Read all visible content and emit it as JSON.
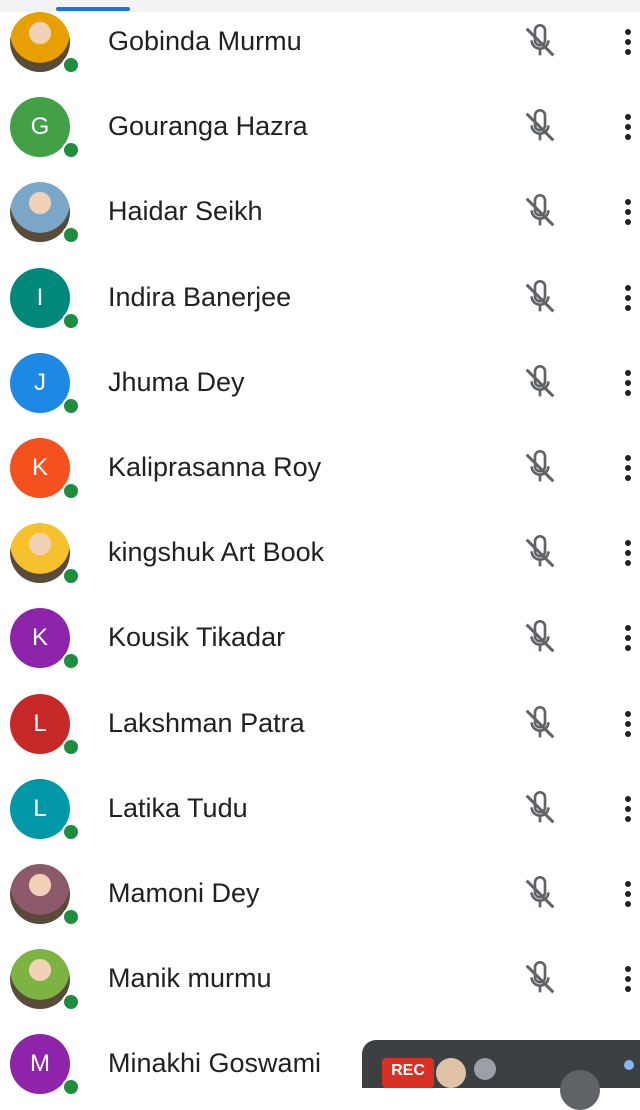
{
  "participants": [
    {
      "name": "Gobinda Murmu",
      "initial": "",
      "avatar": "photo",
      "color": "#e8a000"
    },
    {
      "name": "Gouranga Hazra",
      "initial": "G",
      "avatar": "letter",
      "color": "#43a047"
    },
    {
      "name": "Haidar Seikh",
      "initial": "",
      "avatar": "photo",
      "color": "#7aa6c8"
    },
    {
      "name": "Indira Banerjee",
      "initial": "I",
      "avatar": "letter",
      "color": "#00897b"
    },
    {
      "name": "Jhuma Dey",
      "initial": "J",
      "avatar": "letter",
      "color": "#1e88e5"
    },
    {
      "name": "Kaliprasanna Roy",
      "initial": "K",
      "avatar": "letter",
      "color": "#f4511e"
    },
    {
      "name": "kingshuk Art Book",
      "initial": "",
      "avatar": "photo",
      "color": "#f6c12d"
    },
    {
      "name": "Kousik Tikadar",
      "initial": "K",
      "avatar": "letter",
      "color": "#8e24aa"
    },
    {
      "name": "Lakshman Patra",
      "initial": "L",
      "avatar": "letter",
      "color": "#c62828"
    },
    {
      "name": "Latika Tudu",
      "initial": "L",
      "avatar": "letter",
      "color": "#0097a7"
    },
    {
      "name": "Mamoni Dey",
      "initial": "",
      "avatar": "photo",
      "color": "#8d5a6b"
    },
    {
      "name": "Manik murmu",
      "initial": "",
      "avatar": "photo",
      "color": "#7cb342"
    },
    {
      "name": "Minakhi Goswami",
      "initial": "M",
      "avatar": "letter",
      "color": "#8e24aa"
    }
  ],
  "icons": {
    "mic": "mic-off-icon",
    "more": "more-vert-icon"
  },
  "overlay": {
    "rec_label": "REC"
  },
  "colors": {
    "status": "#1e8e3e",
    "accent": "#1a73e8",
    "rec": "#d93025"
  }
}
